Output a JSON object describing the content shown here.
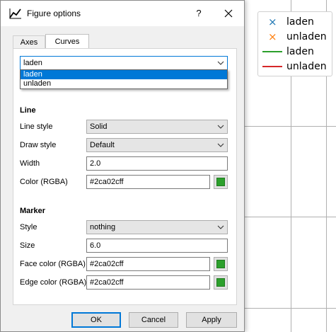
{
  "dialog": {
    "title": "Figure options",
    "help_label": "?",
    "close_label": "✕",
    "app_icon": "line-chart-icon"
  },
  "tabs": [
    {
      "label": "Axes",
      "active": false
    },
    {
      "label": "Curves",
      "active": true
    }
  ],
  "curve_selector": {
    "value": "laden",
    "options": [
      "laden",
      "unladen"
    ],
    "highlighted": "laden"
  },
  "line_section": {
    "heading": "Line",
    "line_style_label": "Line style",
    "line_style_value": "Solid",
    "draw_style_label": "Draw style",
    "draw_style_value": "Default",
    "width_label": "Width",
    "width_value": "2.0",
    "color_label": "Color (RGBA)",
    "color_value": "#2ca02cff",
    "color_swatch": "#2ca02c"
  },
  "marker_section": {
    "heading": "Marker",
    "style_label": "Style",
    "style_value": "nothing",
    "size_label": "Size",
    "size_value": "6.0",
    "face_color_label": "Face color (RGBA)",
    "face_color_value": "#2ca02cff",
    "edge_color_label": "Edge color (RGBA)",
    "edge_color_value": "#2ca02cff",
    "swatch": "#2ca02c"
  },
  "buttons": {
    "ok": "OK",
    "cancel": "Cancel",
    "apply": "Apply"
  },
  "legend": {
    "entries": [
      {
        "label": "laden",
        "marker": "x",
        "color": "#1f77b4"
      },
      {
        "label": "unladen",
        "marker": "x",
        "color": "#ff7f0e"
      },
      {
        "label": "laden",
        "marker": "line",
        "color": "#2ca02c"
      },
      {
        "label": "unladen",
        "marker": "line",
        "color": "#d62728"
      }
    ]
  }
}
